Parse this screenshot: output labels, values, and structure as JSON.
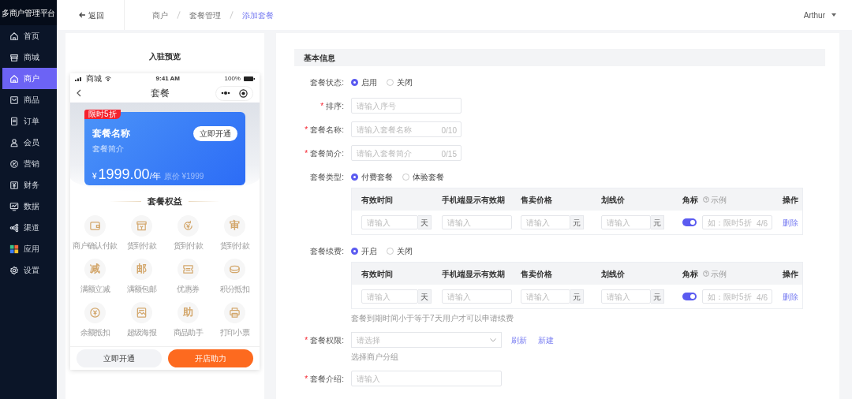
{
  "sidebar": {
    "title": "多商户管理平台",
    "items": [
      {
        "label": "首页",
        "selected": false
      },
      {
        "label": "商城",
        "selected": false
      },
      {
        "label": "商户",
        "selected": true
      },
      {
        "label": "商品",
        "selected": false
      },
      {
        "label": "订单",
        "selected": false
      },
      {
        "label": "会员",
        "selected": false
      },
      {
        "label": "营销",
        "selected": false
      },
      {
        "label": "财务",
        "selected": false
      },
      {
        "label": "数据",
        "selected": false
      },
      {
        "label": "渠道",
        "selected": false
      },
      {
        "label": "应用",
        "selected": false
      },
      {
        "label": "设置",
        "selected": false
      }
    ]
  },
  "header": {
    "back": "返回",
    "breadcrumb": [
      {
        "label": "商户",
        "selected": false
      },
      {
        "label": "套餐管理",
        "selected": false
      },
      {
        "label": "添加套餐",
        "selected": true
      }
    ],
    "user": "Arthur"
  },
  "preview": {
    "title": "入驻预览",
    "phone": {
      "carrier": "商城",
      "time": "9:41 AM",
      "battery": "100%",
      "nav_title": "套餐",
      "card": {
        "tag": "限时5折",
        "name": "套餐名称",
        "intro": "套餐简介",
        "button": "立即开通",
        "currency": "¥",
        "amount": "1999.00",
        "unit": "/年",
        "original_price": "原价 ¥1999"
      },
      "benefits_title": "套餐权益",
      "benefits": [
        {
          "label": "商户确认付款"
        },
        {
          "label": "货到付款"
        },
        {
          "label": "货到付款"
        },
        {
          "label": "货到付款",
          "glyph": "审"
        },
        {
          "label": "满额立减",
          "glyph": "减"
        },
        {
          "label": "满额包邮",
          "glyph": "邮"
        },
        {
          "label": "优惠券"
        },
        {
          "label": "积分抵扣"
        },
        {
          "label": "余额抵扣"
        },
        {
          "label": "超级海报"
        },
        {
          "label": "商品助手",
          "glyph": "助"
        },
        {
          "label": "打印小票"
        }
      ],
      "footer": [
        {
          "label": "立即开通",
          "kind": "secondary"
        },
        {
          "label": "开店助力",
          "kind": "primary"
        }
      ]
    }
  },
  "form": {
    "section_title": "基本信息",
    "rows": [
      {
        "kind": "radio",
        "label": "套餐状态:",
        "options": [
          {
            "label": "启用",
            "selected": true
          },
          {
            "label": "关闭",
            "selected": false
          }
        ]
      },
      {
        "kind": "input",
        "label": "排序:",
        "required_mark": "*",
        "placeholder": "请输入序号"
      },
      {
        "kind": "input",
        "label": "套餐名称:",
        "required_mark": "*",
        "placeholder": "请输入套餐名称",
        "counter": "0/10"
      },
      {
        "kind": "input",
        "label": "套餐简介:",
        "required_mark": "*",
        "placeholder": "请输入套餐简介",
        "counter": "0/15"
      },
      {
        "kind": "radio",
        "label": "套餐类型:",
        "options": [
          {
            "label": "付费套餐",
            "selected": true
          },
          {
            "label": "体验套餐",
            "selected": false
          }
        ],
        "table": {
          "columns": [
            {
              "label": "有效时间"
            },
            {
              "label": "手机端显示有效期"
            },
            {
              "label": "售卖价格"
            },
            {
              "label": "划线价"
            },
            {
              "label": "角标",
              "help": "示例"
            },
            {
              "label": "操作"
            }
          ],
          "cells": [
            {
              "kind": "addon",
              "placeholder": "请输入",
              "addon": "天"
            },
            {
              "kind": "plain",
              "placeholder": "请输入"
            },
            {
              "kind": "addon",
              "placeholder": "请输入",
              "addon": "元"
            },
            {
              "kind": "addon",
              "placeholder": "请输入",
              "addon": "元"
            },
            {
              "kind": "badge",
              "on": true,
              "placeholder": "如：限时5折",
              "counter": "4/6"
            },
            {
              "kind": "link",
              "label": "删除"
            }
          ]
        }
      },
      {
        "kind": "radio",
        "label": "套餐续费:",
        "options": [
          {
            "label": "开启",
            "selected": true
          },
          {
            "label": "关闭",
            "selected": false
          }
        ],
        "table": {
          "columns": [
            {
              "label": "有效时间"
            },
            {
              "label": "手机端显示有效期"
            },
            {
              "label": "售卖价格"
            },
            {
              "label": "划线价"
            },
            {
              "label": "角标",
              "help": "示例"
            },
            {
              "label": "操作"
            }
          ],
          "cells": [
            {
              "kind": "addon",
              "placeholder": "请输入",
              "addon": "天"
            },
            {
              "kind": "plain",
              "placeholder": "请输入"
            },
            {
              "kind": "addon",
              "placeholder": "请输入",
              "addon": "元"
            },
            {
              "kind": "addon",
              "placeholder": "请输入",
              "addon": "元"
            },
            {
              "kind": "badge",
              "on": true,
              "placeholder": "如：限时5折",
              "counter": "4/6"
            },
            {
              "kind": "link",
              "label": "删除"
            }
          ]
        },
        "hint": "套餐到期时间小于等于7天用户才可以申请续费"
      },
      {
        "kind": "select",
        "label": "套餐权限:",
        "required_mark": "*",
        "placeholder": "请选择",
        "links": [
          "刷新",
          "新建"
        ],
        "hint": "选择商户分组"
      },
      {
        "kind": "longinput",
        "label": "套餐介绍:",
        "required_mark": "*",
        "placeholder": "请输入"
      }
    ]
  }
}
